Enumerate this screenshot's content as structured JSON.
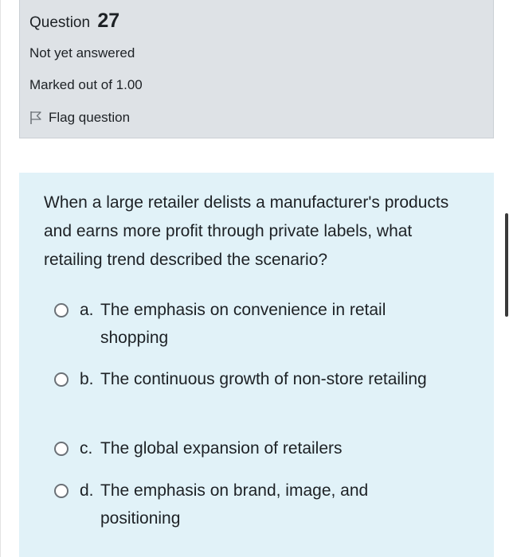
{
  "info": {
    "question_label": "Question",
    "question_number": "27",
    "state": "Not yet answered",
    "grade": "Marked out of 1.00",
    "flag_label": "Flag question",
    "flag_icon": "flag-icon"
  },
  "question": {
    "text": "When a large retailer delists a manufacturer's products and earns more profit through private labels, what retailing trend described the scenario?",
    "options": [
      {
        "letter": "a.",
        "text": "The emphasis on convenience in retail shopping"
      },
      {
        "letter": "b.",
        "text": "The continuous growth of non-store retailing"
      },
      {
        "letter": "c.",
        "text": "The global expansion of retailers"
      },
      {
        "letter": "d.",
        "text": "The emphasis on brand, image, and positioning"
      }
    ]
  },
  "colors": {
    "info_background": "#dee2e6",
    "question_background": "#e1f2f8",
    "text": "#1d2125",
    "radio_border": "#6b7177"
  }
}
